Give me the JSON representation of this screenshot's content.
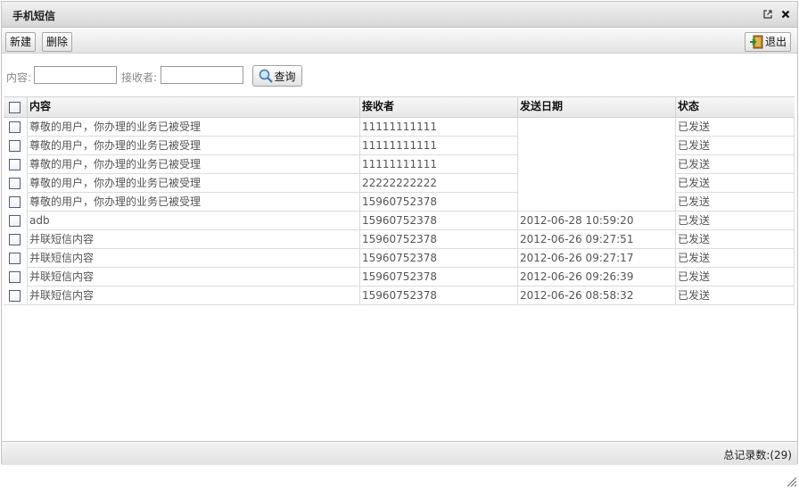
{
  "window": {
    "title": "手机短信"
  },
  "toolbar": {
    "new_label": "新建",
    "delete_label": "删除",
    "exit_label": "退出"
  },
  "search": {
    "content_label": "内容:",
    "content_value": "",
    "receiver_label": "接收者:",
    "receiver_value": "",
    "query_label": "查询"
  },
  "table": {
    "columns": [
      "内容",
      "接收者",
      "发送日期",
      "状态"
    ],
    "rows": [
      {
        "content": "尊敬的用户，你办理的业务已被受理",
        "receiver": "11111111111",
        "date": "",
        "status": "已发送"
      },
      {
        "content": "尊敬的用户，你办理的业务已被受理",
        "receiver": "11111111111",
        "date": "",
        "status": "已发送"
      },
      {
        "content": "尊敬的用户，你办理的业务已被受理",
        "receiver": "11111111111",
        "date": "",
        "status": "已发送"
      },
      {
        "content": "尊敬的用户，你办理的业务已被受理",
        "receiver": "22222222222",
        "date": "",
        "status": "已发送"
      },
      {
        "content": "尊敬的用户，你办理的业务已被受理",
        "receiver": "15960752378",
        "date": "",
        "status": "已发送"
      },
      {
        "content": "adb",
        "receiver": "15960752378",
        "date": "2012-06-28 10:59:20",
        "status": "已发送"
      },
      {
        "content": "并联短信内容",
        "receiver": "15960752378",
        "date": "2012-06-26 09:27:51",
        "status": "已发送"
      },
      {
        "content": "并联短信内容",
        "receiver": "15960752378",
        "date": "2012-06-26 09:27:17",
        "status": "已发送"
      },
      {
        "content": "并联短信内容",
        "receiver": "15960752378",
        "date": "2012-06-26 09:26:39",
        "status": "已发送"
      },
      {
        "content": "并联短信内容",
        "receiver": "15960752378",
        "date": "2012-06-26 08:58:32",
        "status": "已发送"
      }
    ]
  },
  "footer": {
    "total_label": "总记录数:(29)"
  },
  "icons": {
    "popout": "external-link-icon",
    "close": "close-icon",
    "exit": "exit-door-icon",
    "search": "magnifier-icon",
    "resize": "resize-grip-icon"
  }
}
